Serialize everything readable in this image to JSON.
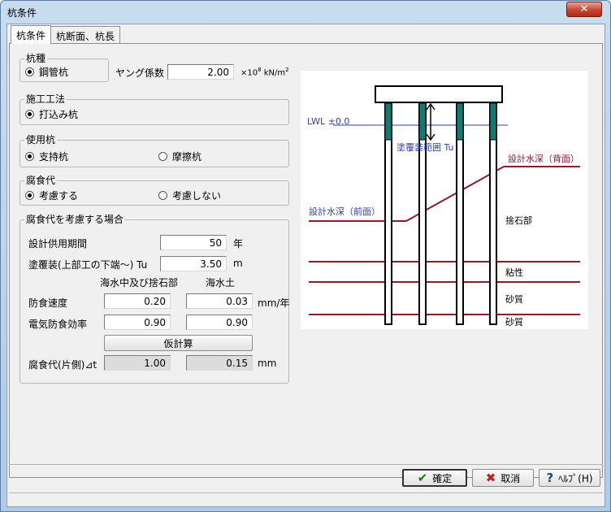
{
  "window": {
    "title": "杭条件",
    "close_label": "✕"
  },
  "tabs": [
    {
      "label": "杭条件"
    },
    {
      "label": "杭断面、杭長"
    }
  ],
  "pile_type": {
    "label": "杭種",
    "option": "鋼管杭",
    "youngs_label": "ヤング係数",
    "youngs_value": "2.00",
    "youngs_unit_prefix": "×10",
    "youngs_unit_exp": "8",
    "youngs_unit_suffix": "kN/m",
    "youngs_unit_sq": "2"
  },
  "method": {
    "label": "施工工法",
    "option": "打込み杭"
  },
  "usage": {
    "label": "使用杭",
    "options": [
      "支持杭",
      "摩擦杭"
    ]
  },
  "corrosion": {
    "label": "腐食代",
    "options": [
      "考慮する",
      "考慮しない"
    ]
  },
  "consider": {
    "label": "腐食代を考慮する場合",
    "service_label": "設計供用期間",
    "service_value": "50",
    "service_unit": "年",
    "coat_label": "塗覆装(上部工の下端～) Tu",
    "coat_value": "3.50",
    "coat_unit": "m",
    "col1": "海水中及び捨石部",
    "col2": "海水土",
    "rate_label": "防食速度",
    "rate1": "0.20",
    "rate2": "0.03",
    "rate_unit": "mm/年",
    "eff_label": "電気防食効率",
    "eff1": "0.90",
    "eff2": "0.90",
    "calc_button": "仮計算",
    "allow_label": "腐食代(片側)⊿t",
    "allow1": "1.00",
    "allow2": "0.15",
    "allow_unit": "mm"
  },
  "diagram": {
    "lwl": "LWL ±0.0",
    "coat_range": "塗覆装範囲 Tu",
    "back_depth": "設計水深（背面）",
    "front_depth": "設計水深（前面）",
    "layers": [
      "捨石部",
      "粘性",
      "砂質",
      "砂質"
    ],
    "colors": {
      "line": "#8b1a2b",
      "blue": "#2d3ea8",
      "teal": "#137a72"
    }
  },
  "buttons": {
    "ok": "確定",
    "cancel": "取消",
    "help": "ﾍﾙﾌﾟ(H)"
  }
}
